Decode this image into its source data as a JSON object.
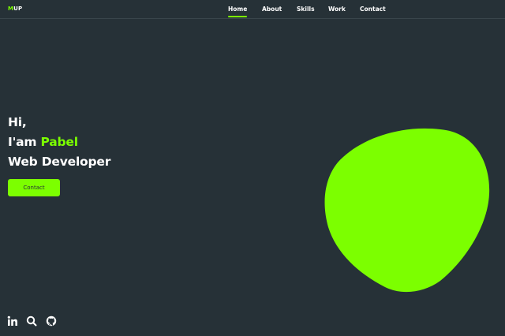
{
  "brand": {
    "logo_accent": "M",
    "logo_rest": "UP"
  },
  "nav": {
    "items": [
      {
        "label": "Home",
        "active": true
      },
      {
        "label": "About",
        "active": false
      },
      {
        "label": "Skills",
        "active": false
      },
      {
        "label": "Work",
        "active": false
      },
      {
        "label": "Contact",
        "active": false
      }
    ]
  },
  "hero": {
    "greeting": "Hi,",
    "intro_prefix": "I'am ",
    "name": "Pabel",
    "role": "Web Developer",
    "cta_label": "Contact"
  },
  "socials": [
    {
      "icon": "linkedin-icon"
    },
    {
      "icon": "search-icon"
    },
    {
      "icon": "github-icon"
    }
  ],
  "colors": {
    "background": "#263137",
    "accent": "#7cff00",
    "text": "#ffffff"
  }
}
